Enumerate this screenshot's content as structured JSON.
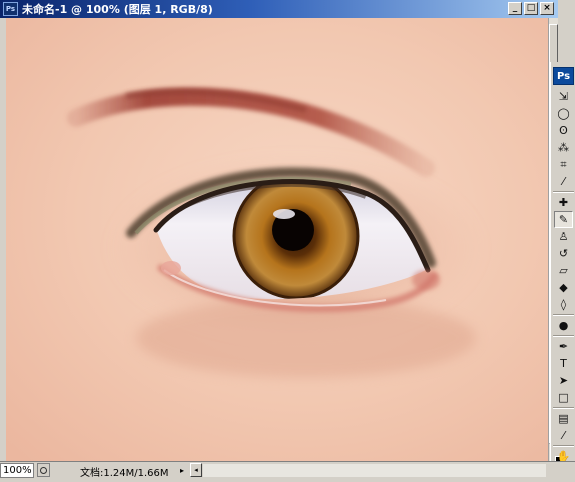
{
  "window": {
    "title": "未命名-1 @ 100% (图层 1, RGB/8)",
    "app_badge": "Ps",
    "buttons": {
      "minimize": "_",
      "maximize": "□",
      "close": "×"
    }
  },
  "status": {
    "zoom": "100%",
    "doc_info": "文档:1.24M/1.66M",
    "menu_arrow": "▸",
    "scroll_left": "◂"
  },
  "toolbox": {
    "logo": "Ps",
    "tools": [
      {
        "name": "move-tool",
        "glyph": "⇲"
      },
      {
        "name": "marquee-tool",
        "glyph": "◯"
      },
      {
        "name": "lasso-tool",
        "glyph": "ʘ"
      },
      {
        "name": "magic-wand-tool",
        "glyph": "⁂"
      },
      {
        "name": "crop-tool",
        "glyph": "⌗"
      },
      {
        "name": "slice-tool",
        "glyph": "⁄"
      },
      {
        "name": "healing-brush-tool",
        "glyph": "✚"
      },
      {
        "name": "brush-tool",
        "glyph": "✎"
      },
      {
        "name": "clone-stamp-tool",
        "glyph": "♙"
      },
      {
        "name": "history-brush-tool",
        "glyph": "↺"
      },
      {
        "name": "eraser-tool",
        "glyph": "▱"
      },
      {
        "name": "paint-bucket-tool",
        "glyph": "◆"
      },
      {
        "name": "blur-tool",
        "glyph": "◊"
      },
      {
        "name": "dodge-tool",
        "glyph": "●"
      },
      {
        "name": "pen-tool",
        "glyph": "✒"
      },
      {
        "name": "type-tool",
        "glyph": "T"
      },
      {
        "name": "path-selection-tool",
        "glyph": "➤"
      },
      {
        "name": "shape-tool",
        "glyph": "□"
      },
      {
        "name": "notes-tool",
        "glyph": "▤"
      },
      {
        "name": "eyedropper-tool",
        "glyph": "⁄"
      },
      {
        "name": "hand-tool",
        "glyph": "✋"
      },
      {
        "name": "zoom-tool",
        "glyph": "⚲"
      }
    ],
    "active_tool": "brush-tool"
  },
  "colors": {
    "title_gradient_start": "#0a246a",
    "title_gradient_end": "#a6caf0",
    "skin": "#f0c6ae",
    "iris": "#a0661c"
  }
}
